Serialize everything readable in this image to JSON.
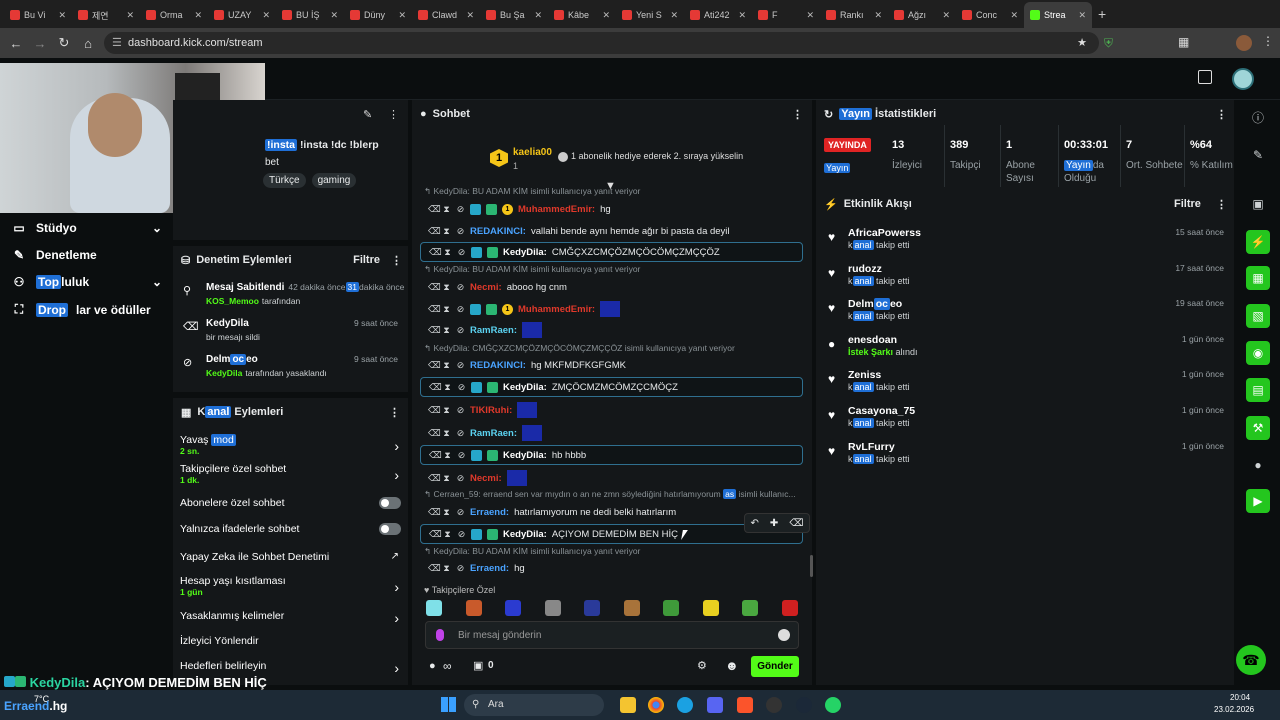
{
  "browser": {
    "tabs": [
      {
        "title": "Bu Vi",
        "color": "#e53935"
      },
      {
        "title": "제연",
        "color": "#e53935"
      },
      {
        "title": "Orma",
        "color": "#e53935"
      },
      {
        "title": "UZAY",
        "color": "#e53935"
      },
      {
        "title": "BU İŞ",
        "color": "#e53935"
      },
      {
        "title": "Düny",
        "color": "#e53935"
      },
      {
        "title": "Clawd",
        "color": "#e53935"
      },
      {
        "title": "Bu Şa",
        "color": "#e53935"
      },
      {
        "title": "Kâbe",
        "color": "#e53935"
      },
      {
        "title": "Yeni S",
        "color": "#e53935"
      },
      {
        "title": "Ati242",
        "color": "#e53935"
      },
      {
        "title": "F",
        "color": "#e53935"
      },
      {
        "title": "Rankı",
        "color": "#e53935"
      },
      {
        "title": "Ağzı",
        "color": "#e53935"
      },
      {
        "title": "Conc",
        "color": "#e53935"
      },
      {
        "title": "Strea",
        "color": "#53fc18",
        "active": true
      }
    ],
    "url": "dashboard.kick.com/stream"
  },
  "stream_info": {
    "title_prefix": "",
    "title_hl": "",
    "title_rest": "!insta !dc !blerp",
    "title_line2": "bet",
    "tags": [
      "Türkçe",
      "gaming"
    ]
  },
  "left_menu": [
    {
      "label": "Stüdyo",
      "icon": "monitor-icon",
      "chevron": true
    },
    {
      "label": "Denetleme",
      "icon": "wrench-icon",
      "chevron": false
    },
    {
      "label_hl": "Top",
      "label": "luluk",
      "icon": "users-icon",
      "chevron": true
    },
    {
      "label_hl": "Drop",
      "label": "lar ve ödüller",
      "icon": "gift-icon",
      "chevron": false
    }
  ],
  "moderation": {
    "title": "Denetim Eylemleri",
    "filter": "Filtre",
    "items": [
      {
        "title": "Mesaj Sabitlendi",
        "time": "42 dakika önce",
        "time_hl": "31",
        "time_rest": "dakika önce",
        "user": "KOS_Memoo",
        "rest": "tarafından",
        "icon": "pin-icon"
      },
      {
        "title": "KedyDila",
        "time": "9 saat önce",
        "sub": "bir mesajı sildi",
        "icon": "trash-icon"
      },
      {
        "title_a": "Delm",
        "title_hl": "oc",
        "title_b": "eo",
        "time": "9 saat önce",
        "user": "KedyDila",
        "rest": "tarafından yasaklandı",
        "icon": "ban-icon"
      }
    ]
  },
  "channel_actions": {
    "title_a": "K",
    "title_hl": "anal",
    "title_b": " Eylemleri",
    "items": [
      {
        "label": "Yavaş",
        "label_hl": "mod",
        "sub": "2 sn.",
        "control": "chevron"
      },
      {
        "label": "Takipçilere özel sohbet",
        "sub": "1 dk.",
        "control": "chevron"
      },
      {
        "label": "Abonelere özel sohbet",
        "control": "toggle"
      },
      {
        "label": "Yalnızca ifadelerle sohbet",
        "control": "toggle"
      },
      {
        "label": "Yapay Zeka ile Sohbet Denetimi",
        "control": "external"
      },
      {
        "label": "Hesap yaşı kısıtlaması",
        "sub": "1 gün",
        "control": "chevron"
      },
      {
        "label": "Yasaklanmış kelimeler",
        "control": "chevron"
      },
      {
        "label": "İzleyici Yönlendir",
        "control": "none"
      },
      {
        "label": "Hedefleri belirleyin",
        "control": "chevron"
      }
    ]
  },
  "chat": {
    "title": "Sohbet",
    "pinned_user": "kaelia00",
    "pinned_rank": "1",
    "pinned_count": "1",
    "pinned_msg": "1 abonelik hediye ederek 2. sıraya yükselin",
    "lines": [
      {
        "type": "reply",
        "text": "KedyDila: BU ADAM KİM isimli kullanıcıya yanıt veriyor"
      },
      {
        "type": "msg",
        "user": "MuhammedEmir",
        "ucls": "u-red",
        "msg": "hg",
        "coin": "1",
        "boxed": false
      },
      {
        "type": "msg",
        "user": "REDAKINCI",
        "ucls": "u-blue",
        "msg": "vallahi bende aynı hemde ağır bi pasta da deyil",
        "boxed": false
      },
      {
        "type": "msg",
        "user": "KedyDila",
        "ucls": "u-white",
        "msg": "CMĞÇXZCMÇÖZMÇÖCÖMÇZMÇÇÖZ",
        "boxed": true
      },
      {
        "type": "reply",
        "text": "KedyDila: BU ADAM KİM isimli kullanıcıya yanıt veriyor"
      },
      {
        "type": "msg",
        "user": "Necmi",
        "ucls": "u-red",
        "msg": "abooo hg cnm",
        "boxed": false
      },
      {
        "type": "msg",
        "user": "MuhammedEmir",
        "ucls": "u-red",
        "msg": "",
        "coin": "1",
        "blur": true,
        "boxed": false
      },
      {
        "type": "msg",
        "user": "RamRaen",
        "ucls": "u-cyan",
        "msg": "",
        "blur": true,
        "boxed": false
      },
      {
        "type": "reply",
        "text": "KedyDila: CMĞÇXZCMÇÖZMÇÖCÖMÇZMÇÇÖZ isimli kullanıcıya yanıt veriyor"
      },
      {
        "type": "msg",
        "user": "REDAKINCI",
        "ucls": "u-blue",
        "msg": "hg MKFMDFKGFGMK",
        "boxed": false
      },
      {
        "type": "msg",
        "user": "KedyDila",
        "ucls": "u-white",
        "msg": "ZMÇÖCMZMCÖMZÇCMÖÇZ",
        "boxed": true
      },
      {
        "type": "msg",
        "user": "TIKIRuhi",
        "ucls": "u-red",
        "msg": "",
        "blur": true,
        "boxed": false
      },
      {
        "type": "msg",
        "user": "RamRaen",
        "ucls": "u-cyan",
        "msg": "",
        "blur": true,
        "boxed": false
      },
      {
        "type": "msg",
        "user": "KedyDila",
        "ucls": "u-white",
        "msg": "hb hbbb",
        "boxed": true
      },
      {
        "type": "msg",
        "user": "Necmi",
        "ucls": "u-red",
        "msg": "",
        "blur": true,
        "boxed": false
      },
      {
        "type": "reply",
        "text": "Cerraen_59: erraend sen var mıydın o an ne zmn söylediğini hatırlamıyorum ",
        "hl": "as",
        "tail": " isimli kullanıc..."
      },
      {
        "type": "msg",
        "user": "Erraend",
        "ucls": "u-blue",
        "msg": "hatırlamıyorum ne dedi belki hatırlarım",
        "boxed": false
      },
      {
        "type": "msg",
        "user": "KedyDila",
        "ucls": "u-white",
        "msg": "AÇIYOM DEMEDİM BEN HİÇ",
        "boxed": true,
        "hover": true
      },
      {
        "type": "reply",
        "text": "KedyDila: BU ADAM KİM isimli kullanıcıya yanıt veriyor"
      },
      {
        "type": "msg",
        "user": "Erraend",
        "ucls": "u-blue",
        "msg": "hg",
        "boxed": false
      }
    ],
    "emote_section": "Takipçilere Özel",
    "input_placeholder": "Bir mesaj gönderin",
    "points": "∞",
    "gift_count": "0",
    "send": "Gönder"
  },
  "stats": {
    "title_hl": "Yayın",
    "title_rest": " İstatistikleri",
    "live_a": "YAYIN",
    "live_b": "DA",
    "live_hl": "Yayın",
    "cells": [
      {
        "value": "13",
        "label": "İzleyici"
      },
      {
        "value": "389",
        "label": "Takipçi"
      },
      {
        "value": "1",
        "label": "Abone Sayısı"
      },
      {
        "value": "00:33:01",
        "label_hl": "Yayın",
        "label": "da Olduğu"
      },
      {
        "value": "7",
        "label": "Ort. Sohbete"
      },
      {
        "value": "%64",
        "label": "% Katılım"
      }
    ]
  },
  "activity": {
    "title": "Etkinlik Akışı",
    "filter": "Filtre",
    "items": [
      {
        "name": "AfricaPowerss",
        "pre": "k",
        "hl": "anal",
        "rest": " takip etti",
        "time": "15 saat önce",
        "icon": "heart-icon"
      },
      {
        "name": "rudozz",
        "pre": "k",
        "hl": "anal",
        "rest": " takip etti",
        "time": "17 saat önce",
        "icon": "heart-icon"
      },
      {
        "name_a": "Delm",
        "name_hl": "oc",
        "name_b": "eo",
        "pre": "k",
        "hl": "anal",
        "rest": " takip etti",
        "time": "19 saat önce",
        "icon": "heart-icon"
      },
      {
        "name": "enesdoan",
        "special": "İstek Şarkı",
        "rest": " alındı",
        "time": "1 gün önce",
        "icon": "points-icon"
      },
      {
        "name": "Zeniss",
        "pre": "k",
        "hl": "anal",
        "rest": " takip etti",
        "time": "1 gün önce",
        "icon": "heart-icon"
      },
      {
        "name": "Casayona_75",
        "pre": "k",
        "hl": "anal",
        "rest": " takip etti",
        "time": "1 gün önce",
        "icon": "heart-icon"
      },
      {
        "name": "RvLFurry",
        "pre": "k",
        "hl": "anal",
        "rest": " takip etti",
        "time": "1 gün önce",
        "icon": "heart-icon"
      }
    ]
  },
  "overlay": {
    "user": "KedyDila",
    "msg": ": AÇIYOM DEMEDİM BEN HİÇ",
    "user2": "Erraend",
    "msg2": ".hg"
  },
  "taskbar": {
    "search": "Ara",
    "time": "20:04",
    "date": "23.02.2026",
    "weather": "7°C"
  }
}
